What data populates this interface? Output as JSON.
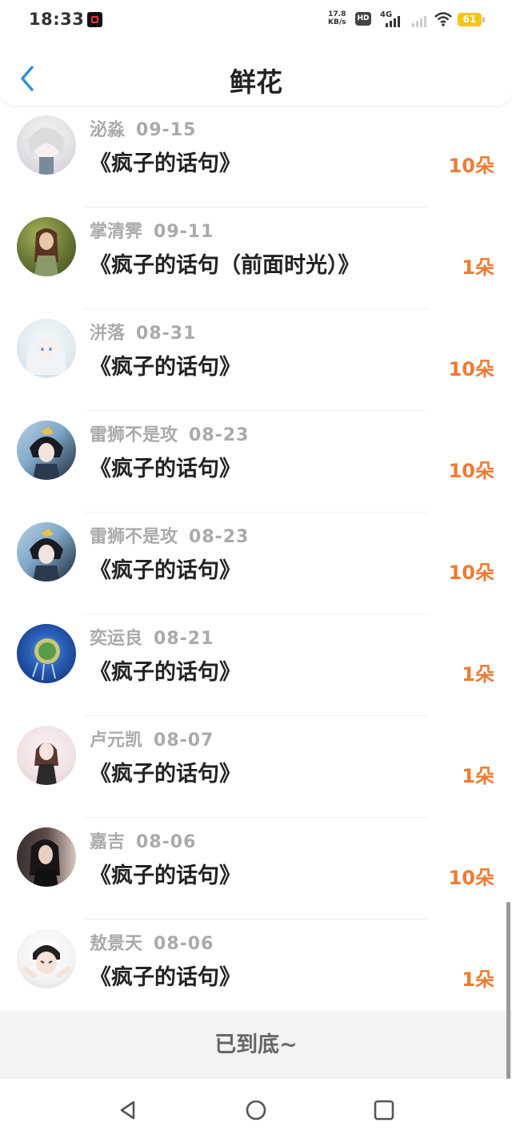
{
  "status_bar": {
    "time": "18:33",
    "net_speed_value": "17.8",
    "net_speed_unit": "KB/s",
    "hd_label": "HD",
    "network_type": "4G",
    "battery": "61",
    "battery_color": "#f5c518"
  },
  "header": {
    "title": "鲜花",
    "back_icon": "chevron-left-icon"
  },
  "colors": {
    "accent": "#2b8fe0",
    "count": "#f07a30",
    "meta": "#aaaaaa"
  },
  "items": [
    {
      "user": "泌淼",
      "date": "09-15",
      "work": "《疯子的话句》",
      "count": "10朵",
      "avatar_colors": [
        "#e8e8e8",
        "#cfc8d8"
      ]
    },
    {
      "user": "掌清霁",
      "date": "09-11",
      "work": "《疯子的话句（前面时光）》",
      "count": "1朵",
      "avatar_colors": [
        "#6b7a35",
        "#3e4a22"
      ]
    },
    {
      "user": "洴落",
      "date": "08-31",
      "work": "《疯子的话句》",
      "count": "10朵",
      "avatar_colors": [
        "#e6eef3",
        "#c8d8e4"
      ]
    },
    {
      "user": "雷狮不是攻",
      "date": "08-23",
      "work": "《疯子的话句》",
      "count": "10朵",
      "avatar_colors": [
        "#7fa8c8",
        "#1d2a3a"
      ]
    },
    {
      "user": "雷狮不是攻",
      "date": "08-23",
      "work": "《疯子的话句》",
      "count": "10朵",
      "avatar_colors": [
        "#7fa8c8",
        "#1d2a3a"
      ]
    },
    {
      "user": "奕运良",
      "date": "08-21",
      "work": "《疯子的话句》",
      "count": "1朵",
      "avatar_colors": [
        "#2a5fb8",
        "#0d2a6e"
      ]
    },
    {
      "user": "卢元凯",
      "date": "08-07",
      "work": "《疯子的话句》",
      "count": "1朵",
      "avatar_colors": [
        "#f1e2e4",
        "#2a2a2a"
      ]
    },
    {
      "user": "嘉吉",
      "date": "08-06",
      "work": "《疯子的话句》",
      "count": "10朵",
      "avatar_colors": [
        "#3a3030",
        "#d8c8c0"
      ]
    },
    {
      "user": "敖景天",
      "date": "08-06",
      "work": "《疯子的话句》",
      "count": "1朵",
      "avatar_colors": [
        "#f3f3f3",
        "#333333"
      ]
    }
  ],
  "footer": {
    "end_text": "已到底~"
  },
  "nav": {
    "back_icon": "triangle-back-icon",
    "home_icon": "circle-home-icon",
    "recents_icon": "square-recents-icon"
  }
}
